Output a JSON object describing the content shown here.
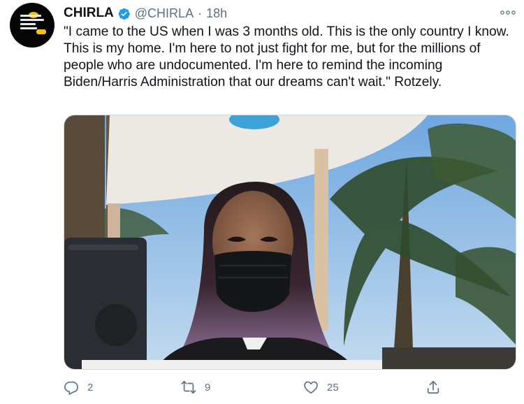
{
  "tweet": {
    "display_name": "CHIRLA",
    "handle": "@CHIRLA",
    "separator": "·",
    "time": "18h",
    "text": "\"I came to the US when I was 3 months old. This is the only country I know. This is my home. I'm here to not just fight for me, but for the millions of people who are undocumented. I'm here to remind the incoming Biden/Harris Administration that our dreams can't wait.\" Rotzely.",
    "avatar_icon": "chirla-logo-avatar",
    "verified_icon": "verified-badge-icon",
    "media_description_icon": "photo",
    "colors": {
      "text": "#0f1419",
      "secondary": "#5b7083",
      "verified": "#1d9bf0"
    }
  },
  "actions": {
    "reply": {
      "icon": "reply-icon",
      "count": "2"
    },
    "retweet": {
      "icon": "retweet-icon",
      "count": "9"
    },
    "like": {
      "icon": "like-icon",
      "count": "25"
    },
    "share": {
      "icon": "share-icon"
    }
  }
}
